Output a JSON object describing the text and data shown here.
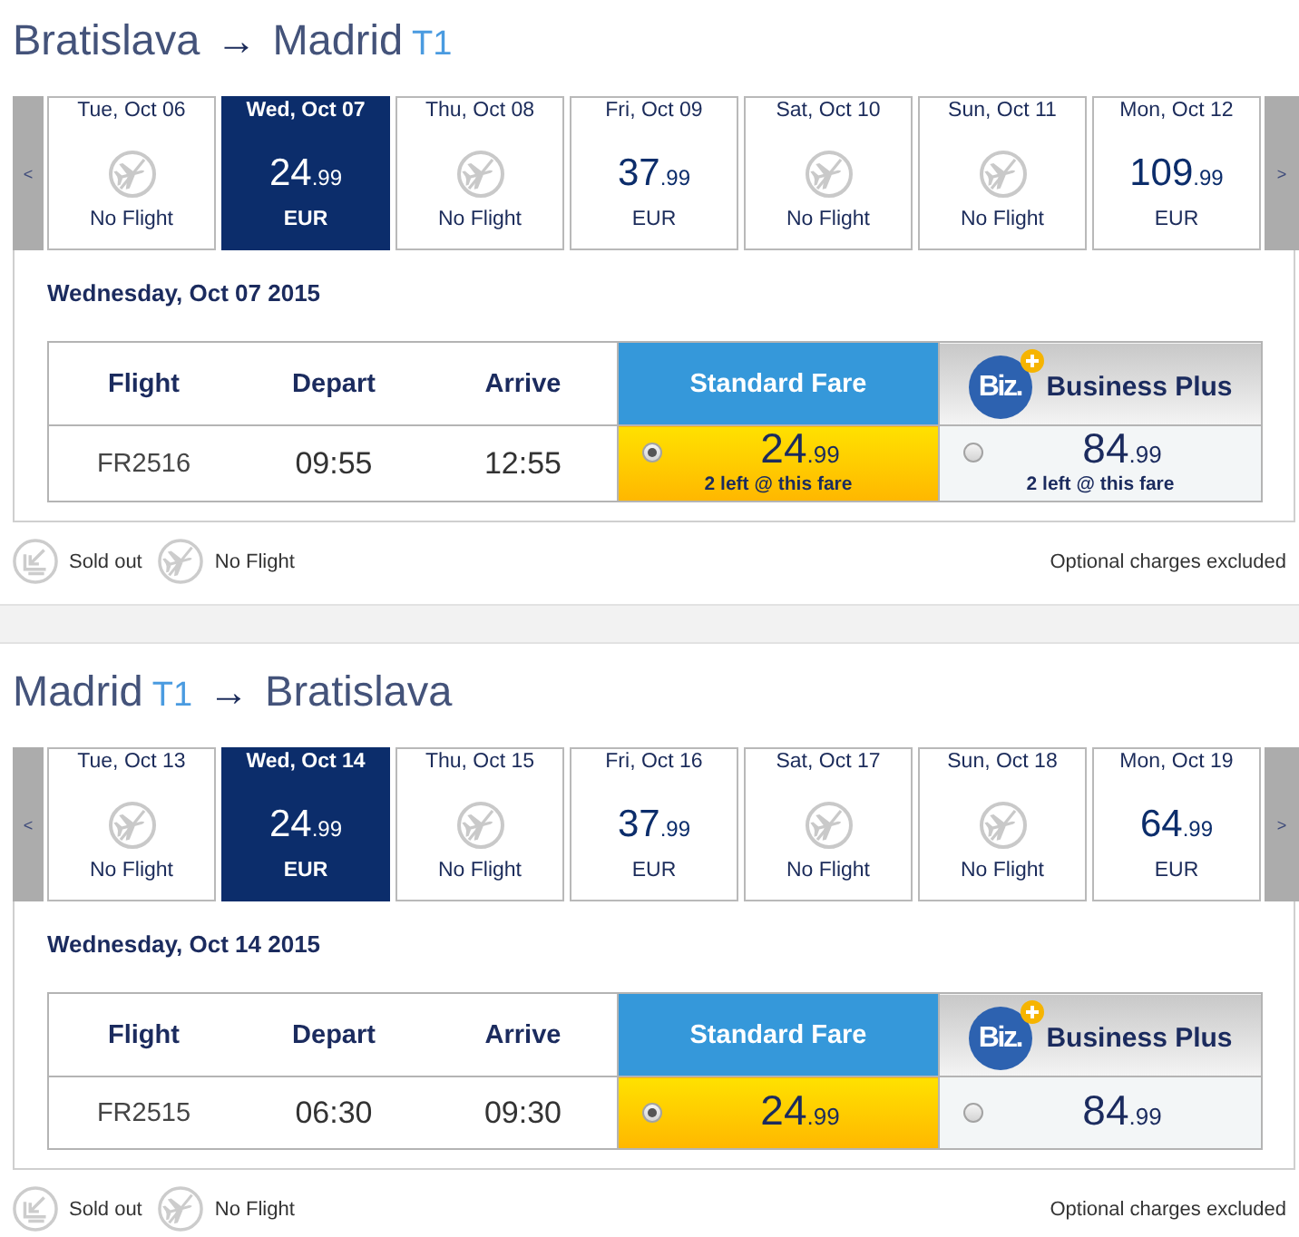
{
  "trips": [
    {
      "title": [
        {
          "kind": "city",
          "text": "Bratislava"
        },
        {
          "kind": "arrow",
          "text": "→"
        },
        {
          "kind": "city",
          "text": "Madrid"
        },
        {
          "kind": "terminal",
          "text": "T1"
        }
      ],
      "date_strip": {
        "prev": "<",
        "next": ">",
        "days": [
          {
            "label": "Tue, Oct 06",
            "kind": "no_flight",
            "note": "No Flight",
            "selected": false
          },
          {
            "label": "Wed, Oct 07",
            "kind": "fare",
            "amount": "24",
            "cents": ".99",
            "currency": "EUR",
            "selected": true
          },
          {
            "label": "Thu, Oct 08",
            "kind": "no_flight",
            "note": "No Flight",
            "selected": false
          },
          {
            "label": "Fri, Oct 09",
            "kind": "fare",
            "amount": "37",
            "cents": ".99",
            "currency": "EUR",
            "selected": false
          },
          {
            "label": "Sat, Oct 10",
            "kind": "no_flight",
            "note": "No Flight",
            "selected": false
          },
          {
            "label": "Sun, Oct 11",
            "kind": "no_flight",
            "note": "No Flight",
            "selected": false
          },
          {
            "label": "Mon, Oct 12",
            "kind": "fare",
            "amount": "109",
            "cents": ".99",
            "currency": "EUR",
            "selected": false
          }
        ]
      },
      "date_heading": "Wednesday, Oct 07 2015",
      "table": {
        "columns": [
          {
            "label": "Flight",
            "kind": "text"
          },
          {
            "label": "Depart",
            "kind": "text"
          },
          {
            "label": "Arrive",
            "kind": "text"
          },
          {
            "label": "Standard Fare",
            "kind": "standard"
          },
          {
            "label": "Business Plus",
            "kind": "business",
            "logo_text": "Biz."
          }
        ],
        "rows": [
          {
            "flight": "FR2516",
            "depart": "09:55",
            "arrive": "12:55",
            "fares": [
              {
                "amount": "24",
                "cents": ".99",
                "note": "2 left @ this fare",
                "selected": true
              },
              {
                "amount": "84",
                "cents": ".99",
                "note": "2 left @ this fare",
                "selected": false
              }
            ]
          }
        ]
      },
      "legend": [
        {
          "kind": "sold_out",
          "label": "Sold out"
        },
        {
          "kind": "no_flight",
          "label": "No Flight"
        }
      ],
      "note": "Optional charges excluded"
    },
    {
      "title": [
        {
          "kind": "city",
          "text": "Madrid"
        },
        {
          "kind": "terminal",
          "text": "T1"
        },
        {
          "kind": "arrow",
          "text": "→"
        },
        {
          "kind": "city",
          "text": "Bratislava"
        }
      ],
      "date_strip": {
        "prev": "<",
        "next": ">",
        "days": [
          {
            "label": "Tue, Oct 13",
            "kind": "no_flight",
            "note": "No Flight",
            "selected": false
          },
          {
            "label": "Wed, Oct 14",
            "kind": "fare",
            "amount": "24",
            "cents": ".99",
            "currency": "EUR",
            "selected": true
          },
          {
            "label": "Thu, Oct 15",
            "kind": "no_flight",
            "note": "No Flight",
            "selected": false
          },
          {
            "label": "Fri, Oct 16",
            "kind": "fare",
            "amount": "37",
            "cents": ".99",
            "currency": "EUR",
            "selected": false
          },
          {
            "label": "Sat, Oct 17",
            "kind": "no_flight",
            "note": "No Flight",
            "selected": false
          },
          {
            "label": "Sun, Oct 18",
            "kind": "no_flight",
            "note": "No Flight",
            "selected": false
          },
          {
            "label": "Mon, Oct 19",
            "kind": "fare",
            "amount": "64",
            "cents": ".99",
            "currency": "EUR",
            "selected": false
          }
        ]
      },
      "date_heading": "Wednesday, Oct 14 2015",
      "table": {
        "columns": [
          {
            "label": "Flight",
            "kind": "text"
          },
          {
            "label": "Depart",
            "kind": "text"
          },
          {
            "label": "Arrive",
            "kind": "text"
          },
          {
            "label": "Standard Fare",
            "kind": "standard"
          },
          {
            "label": "Business Plus",
            "kind": "business",
            "logo_text": "Biz."
          }
        ],
        "rows": [
          {
            "flight": "FR2515",
            "depart": "06:30",
            "arrive": "09:30",
            "fares": [
              {
                "amount": "24",
                "cents": ".99",
                "selected": true
              },
              {
                "amount": "84",
                "cents": ".99",
                "selected": false
              }
            ]
          }
        ]
      },
      "legend": [
        {
          "kind": "sold_out",
          "label": "Sold out"
        },
        {
          "kind": "no_flight",
          "label": "No Flight"
        }
      ],
      "note": "Optional charges excluded"
    }
  ]
}
